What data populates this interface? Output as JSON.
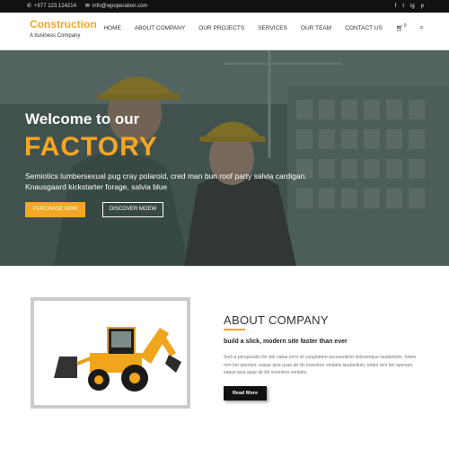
{
  "topbar": {
    "phone": "+977 123 124214",
    "email": "info@wpoperation.com",
    "social": [
      "f",
      "t",
      "ig",
      "p"
    ]
  },
  "brand": {
    "name": "Construction",
    "tagline": "A business Company"
  },
  "nav": {
    "items": [
      "HOME",
      "ABOUT COMPANY",
      "OUR PROJECTS",
      "SERVICES",
      "OUR TEAM",
      "CONTACT US"
    ],
    "cart_count": "0"
  },
  "hero": {
    "welcome": "Welcome to our",
    "headline": "FACTORY",
    "description": "Semiotics lumbersexual pug cray polaroid, cred man bun roof party salvia cardigan. Knausgaard kickstarter forage, salvia blue",
    "primary_button": "PURCHASE NOW",
    "secondary_button": "DISCOVER MOEW"
  },
  "about": {
    "title": "ABOUT COMPANY",
    "subtitle": "build a slick, modern site faster than ever",
    "text": "Sed ut perspiciatis illo iste natue error sit voluptatem accusantium doloremque laudantium, totam rem bet aperiam, eaque ipsa quae ab illo inventore veritatis.laudantium, totam rem bet aperiam, eaque ipsa quae ab illo inventore veritatis.",
    "button": "Read More"
  },
  "colors": {
    "accent": "#f5a623",
    "topbar": "#111111"
  }
}
